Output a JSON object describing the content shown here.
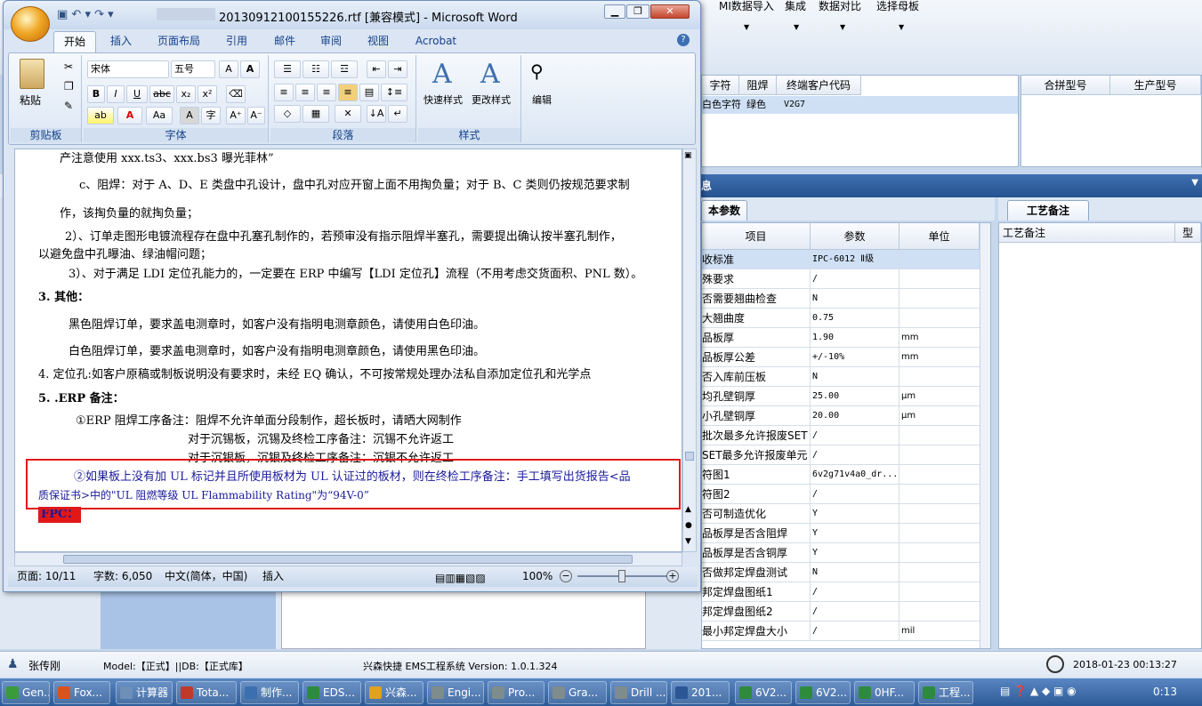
{
  "erp": {
    "menu": [
      "MI数据导入",
      "集成",
      "数据对比",
      "选择母板"
    ],
    "grid1_headers": [
      "字符",
      "阻焊",
      "终端客户代码"
    ],
    "grid1_row": [
      "白色字符",
      "绿色",
      "V2G7"
    ],
    "grid2_headers": [
      "合拼型号",
      "生产型号"
    ],
    "band_title": "息",
    "tab_basic": "本参数",
    "tab_remark": "工艺备注",
    "param_headers": [
      "项目",
      "参数",
      "单位"
    ],
    "params": [
      {
        "name": "收标准",
        "value": "IPC-6012 Ⅱ级",
        "unit": ""
      },
      {
        "name": "殊要求",
        "value": "/",
        "unit": ""
      },
      {
        "name": "否需要翘曲检查",
        "value": "N",
        "unit": ""
      },
      {
        "name": "大翘曲度",
        "value": "0.75",
        "unit": ""
      },
      {
        "name": "品板厚",
        "value": "1.90",
        "unit": "mm"
      },
      {
        "name": "品板厚公差",
        "value": "+/-10%",
        "unit": "mm"
      },
      {
        "name": "否入库前压板",
        "value": "N",
        "unit": ""
      },
      {
        "name": "均孔壁铜厚",
        "value": "25.00",
        "unit": "μm"
      },
      {
        "name": "小孔壁铜厚",
        "value": "20.00",
        "unit": "μm"
      },
      {
        "name": "批次最多允许报废SET",
        "value": "/",
        "unit": ""
      },
      {
        "name": "SET最多允许报废单元",
        "value": "/",
        "unit": ""
      },
      {
        "name": "符图1",
        "value": "6v2g71v4a0_dr...",
        "unit": ""
      },
      {
        "name": "符图2",
        "value": "/",
        "unit": ""
      },
      {
        "name": "否可制造优化",
        "value": "Y",
        "unit": ""
      },
      {
        "name": "品板厚是否含阻焊",
        "value": "Y",
        "unit": ""
      },
      {
        "name": "品板厚是否含铜厚",
        "value": "Y",
        "unit": ""
      },
      {
        "name": "否做邦定焊盘测试",
        "value": "N",
        "unit": ""
      },
      {
        "name": "邦定焊盘图纸1",
        "value": "/",
        "unit": ""
      },
      {
        "name": "邦定焊盘图纸2",
        "value": "/",
        "unit": ""
      },
      {
        "name": "最小邦定焊盘大小",
        "value": "/",
        "unit": "mil"
      }
    ],
    "remark_headers": [
      "工艺备注",
      "型"
    ],
    "status": {
      "user": "张传刚",
      "model": "Model:【正式】||DB:【正式库】",
      "system": "兴森快捷 EMS工程系统 Version: 1.0.1.324",
      "time": "2018-01-23 00:13:27"
    }
  },
  "taskbar": {
    "items": [
      {
        "label": "Gen...",
        "color": "#3a9b3a"
      },
      {
        "label": "Fox...",
        "color": "#d9531e"
      },
      {
        "label": "计算器",
        "color": "#6d8fb8"
      },
      {
        "label": "Tota...",
        "color": "#c0392b"
      },
      {
        "label": "制作...",
        "color": "#3c6fb0"
      },
      {
        "label": "EDS...",
        "color": "#2e8b3e"
      },
      {
        "label": "兴森...",
        "color": "#e0a020"
      },
      {
        "label": "Engi...",
        "color": "#7f8c8d"
      },
      {
        "label": "Pro...",
        "color": "#7f8c8d"
      },
      {
        "label": "Gra...",
        "color": "#7f8c8d"
      },
      {
        "label": "Drill ...",
        "color": "#7f8c8d"
      },
      {
        "label": "201...",
        "color": "#2b5797"
      },
      {
        "label": "6V2...",
        "color": "#2e8b3e"
      },
      {
        "label": "6V2...",
        "color": "#2e8b3e"
      },
      {
        "label": "0HF...",
        "color": "#2e8b3e"
      },
      {
        "label": "工程...",
        "color": "#2e8b3e"
      }
    ],
    "clock": "0:13"
  },
  "word": {
    "title": "20130912100155226.rtf [兼容模式] - Microsoft Word",
    "tabs": [
      "开始",
      "插入",
      "页面布局",
      "引用",
      "邮件",
      "审阅",
      "视图",
      "Acrobat"
    ],
    "font_name": "宋体",
    "font_size": "五号",
    "groups": {
      "clipboard": "剪贴板",
      "font": "字体",
      "paragraph": "段落",
      "style": "样式"
    },
    "paste_label": "粘贴",
    "quick_style_label": "快速样式",
    "change_style_label": "更改样式",
    "edit_label": "编辑",
    "doc_lines": [
      "产注意使用 xxx.ts3、xxx.bs3 曝光菲林”",
      "c、阻焊：对于 A、D、E 类盘中孔设计，盘中孔对应开窗上面不用掏负量；对于 B、C 类则仍按规范要求制",
      "作，该掏负量的就掏负量；",
      "2）、订单走图形电镀流程存在盘中孔塞孔制作的，若预审没有指示阻焊半塞孔，需要提出确认按半塞孔制作，",
      "以避免盘中孔曝油、绿油帽问题；",
      "3）、对于满足 LDI 定位孔能力的，一定要在 ERP 中编写【LDI 定位孔】流程（不用考虑交货面积、PNL 数）。",
      "3. 其他：",
      "黑色阻焊订单，要求盖电测章时，如客户没有指明电测章颜色，请使用白色印油。",
      "白色阻焊订单，要求盖电测章时，如客户没有指明电测章颜色，请使用黑色印油。",
      "4. 定位孔:如客户原稿或制板说明没有要求时，未经 EQ 确认，不可按常规处理办法私自添加定位孔和光学点",
      "5. .ERP 备注：",
      "①ERP 阻焊工序备注：阻焊不允许单面分段制作，超长板时，请晒大网制作",
      "对于沉锡板，沉锡及终检工序备注：沉锡不允许返工",
      "对于沉银板，沉银及终检工序备注：沉银不允许返工",
      "②如果板上没有加 UL 标记并且所使用板材为 UL 认证过的板材，则在终检工序备注：手工填写出货报告<品",
      "质保证书>中的\"UL 阻燃等级 UL Flammability Rating\"为“94V-0”",
      "FPC："
    ],
    "status": {
      "page": "页面: 10/11",
      "words": "字数: 6,050",
      "lang": "中文(简体，中国)",
      "mode": "插入",
      "zoom": "100%"
    }
  }
}
